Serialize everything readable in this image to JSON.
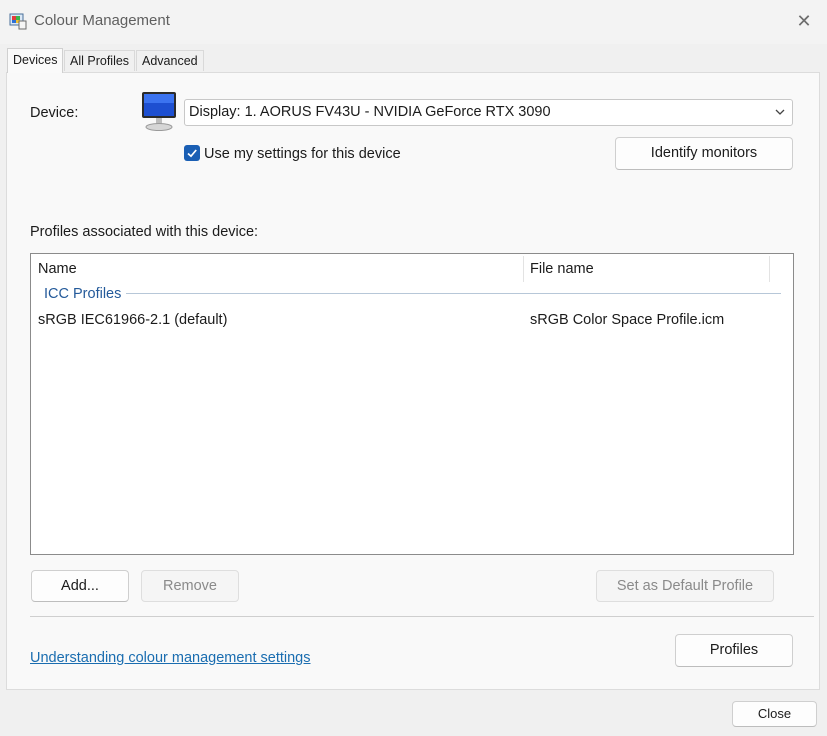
{
  "window": {
    "title": "Colour Management",
    "icon": "colour-management-app-icon",
    "close_glyph": "✕"
  },
  "tabs": [
    {
      "label": "Devices",
      "active": true
    },
    {
      "label": "All Profiles",
      "active": false
    },
    {
      "label": "Advanced",
      "active": false
    }
  ],
  "device": {
    "label": "Device:",
    "icon": "monitor-icon",
    "selected": "Display: 1. AORUS FV43U - NVIDIA GeForce RTX 3090",
    "use_my_settings_label": "Use my settings for this device",
    "use_my_settings_checked": true,
    "identify_button": "Identify monitors"
  },
  "profiles": {
    "section_label": "Profiles associated with this device:",
    "columns": [
      "Name",
      "File name"
    ],
    "group": "ICC Profiles",
    "rows": [
      {
        "name": "sRGB IEC61966-2.1 (default)",
        "file": "sRGB Color Space Profile.icm"
      }
    ]
  },
  "actions": {
    "add": "Add...",
    "remove": "Remove",
    "set_default": "Set as Default Profile",
    "profiles": "Profiles"
  },
  "footer": {
    "link": "Understanding colour management settings",
    "close": "Close"
  },
  "colors": {
    "accent": "#1a5fb4",
    "link": "#1a6db0",
    "group_text": "#245a9a"
  }
}
